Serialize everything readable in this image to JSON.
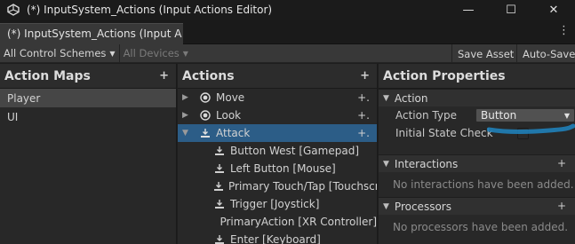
{
  "window": {
    "title": "(*) InputSystem_Actions (Input Actions Editor)",
    "controls": [
      "—",
      "☐",
      "✕"
    ]
  },
  "tab": {
    "label": "(*) InputSystem_Actions (Input A"
  },
  "toolbar": {
    "control_schemes": "All Control Schemes",
    "devices": "All Devices",
    "save_asset": "Save Asset",
    "auto_save": "Auto-Save"
  },
  "action_maps": {
    "header": "Action Maps",
    "items": [
      {
        "label": "Player",
        "selected": true
      },
      {
        "label": "UI",
        "selected": false
      }
    ]
  },
  "actions": {
    "header": "Actions",
    "rows": [
      {
        "label": "Move",
        "icon": "radio-icon",
        "selected": false
      },
      {
        "label": "Look",
        "icon": "radio-icon",
        "selected": false
      },
      {
        "label": "Attack",
        "icon": "button-action-icon",
        "selected": true
      }
    ],
    "bindings": [
      "Button West [Gamepad]",
      "Left Button [Mouse]",
      "Primary Touch/Tap [Touchscr",
      "Trigger [Joystick]",
      "PrimaryAction [XR Controller]",
      "Enter [Keyboard]"
    ]
  },
  "properties": {
    "header": "Action Properties",
    "action_section": "Action",
    "action_type_label": "Action Type",
    "action_type_value": "Button",
    "initial_state_label": "Initial State Check",
    "interactions_section": "Interactions",
    "interactions_empty": "No interactions have been added.",
    "processors_section": "Processors",
    "processors_empty": "No processors have been added."
  },
  "colors": {
    "selection": "#2c5d87",
    "annotation_stroke": "#1f7fb8"
  }
}
